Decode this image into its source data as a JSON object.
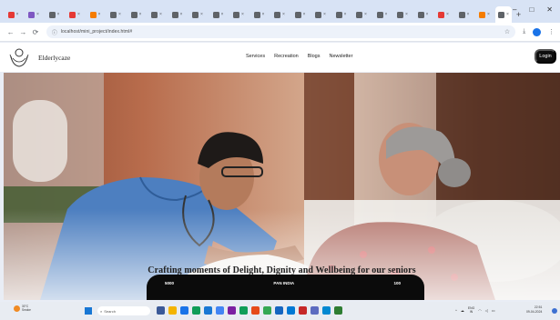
{
  "browser": {
    "tabs": [
      {
        "color": "#e53935",
        "active": false
      },
      {
        "color": "#7e57c2",
        "active": false
      },
      {
        "color": "#5f6368",
        "active": false
      },
      {
        "color": "#e53935",
        "active": false
      },
      {
        "color": "#f57c00",
        "active": false
      },
      {
        "color": "#5f6368",
        "active": false
      },
      {
        "color": "#5f6368",
        "active": false
      },
      {
        "color": "#5f6368",
        "active": false
      },
      {
        "color": "#5f6368",
        "active": false
      },
      {
        "color": "#5f6368",
        "active": false
      },
      {
        "color": "#5f6368",
        "active": false
      },
      {
        "color": "#5f6368",
        "active": false
      },
      {
        "color": "#5f6368",
        "active": false
      },
      {
        "color": "#5f6368",
        "active": false
      },
      {
        "color": "#5f6368",
        "active": false
      },
      {
        "color": "#5f6368",
        "active": false
      },
      {
        "color": "#5f6368",
        "active": false
      },
      {
        "color": "#5f6368",
        "active": false
      },
      {
        "color": "#5f6368",
        "active": false
      },
      {
        "color": "#5f6368",
        "active": false
      },
      {
        "color": "#5f6368",
        "active": false
      },
      {
        "color": "#e53935",
        "active": false
      },
      {
        "color": "#5f6368",
        "active": false
      },
      {
        "color": "#f57c00",
        "active": false
      },
      {
        "color": "#5f6368",
        "active": true
      }
    ],
    "new_tab_label": "+",
    "window_controls": {
      "minimize": "–",
      "maximize": "□",
      "close": "✕"
    },
    "url": "localhost/mini_project/index.html#",
    "nav": {
      "back": "←",
      "forward": "→",
      "reload": "⟳"
    }
  },
  "site": {
    "brand": "Elderlycaze",
    "nav_items": [
      "Services",
      "Recreation",
      "Blogs",
      "Newsletter"
    ],
    "login_label": "Login",
    "tagline": "Crafting moments of Delight, Dignity and Wellbeing for our seniors",
    "stats": [
      "5000",
      "PAN INDIA",
      "100"
    ]
  },
  "taskbar": {
    "weather_temp": "30°C",
    "weather_desc": "Smoke",
    "search_placeholder": "Search",
    "lang_line1": "ENG",
    "lang_line2": "IN",
    "time": "22:51",
    "date": "09-04-2024",
    "app_colors": [
      "#3b5998",
      "#f4b400",
      "#1a73e8",
      "#0f9d58",
      "#1877d4",
      "#4285f4",
      "#7b1fa2",
      "#0f9d58",
      "#e64a19",
      "#34a853",
      "#1565c0",
      "#0078d4",
      "#c62828",
      "#5c6bc0",
      "#0288d1",
      "#2e7d32"
    ]
  },
  "colors": {
    "accent": "#0e0e0e",
    "stats_bar": "#0b0b0b",
    "tab_strip": "#d8e3f5"
  }
}
